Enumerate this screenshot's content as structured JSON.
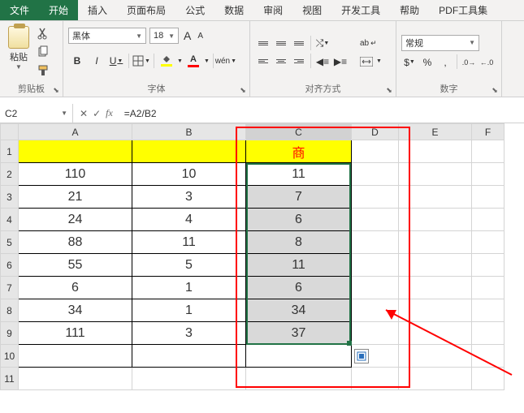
{
  "tabs": {
    "file": "文件",
    "home": "开始",
    "insert": "插入",
    "layout": "页面布局",
    "formulas": "公式",
    "data": "数据",
    "review": "审阅",
    "view": "视图",
    "developer": "开发工具",
    "help": "帮助",
    "pdf": "PDF工具集"
  },
  "ribbon": {
    "clipboard": {
      "label": "剪贴板",
      "paste": "粘贴"
    },
    "font": {
      "label": "字体",
      "name": "黑体",
      "size": "18",
      "increase": "A",
      "decrease": "A",
      "bold": "B",
      "italic": "I",
      "underline": "U"
    },
    "alignment": {
      "label": "对齐方式",
      "wrap": "ab"
    },
    "number": {
      "label": "数字",
      "format": "常规"
    }
  },
  "namebox": "C2",
  "formula": "=A2/B2",
  "columns": [
    "A",
    "B",
    "C",
    "D",
    "E",
    "F"
  ],
  "sheet": {
    "header": {
      "c": "商"
    },
    "rows": [
      {
        "a": "110",
        "b": "10",
        "c": "11"
      },
      {
        "a": "21",
        "b": "3",
        "c": "7"
      },
      {
        "a": "24",
        "b": "4",
        "c": "6"
      },
      {
        "a": "88",
        "b": "11",
        "c": "8"
      },
      {
        "a": "55",
        "b": "5",
        "c": "11"
      },
      {
        "a": "6",
        "b": "1",
        "c": "6"
      },
      {
        "a": "34",
        "b": "1",
        "c": "34"
      },
      {
        "a": "111",
        "b": "3",
        "c": "37"
      }
    ]
  }
}
